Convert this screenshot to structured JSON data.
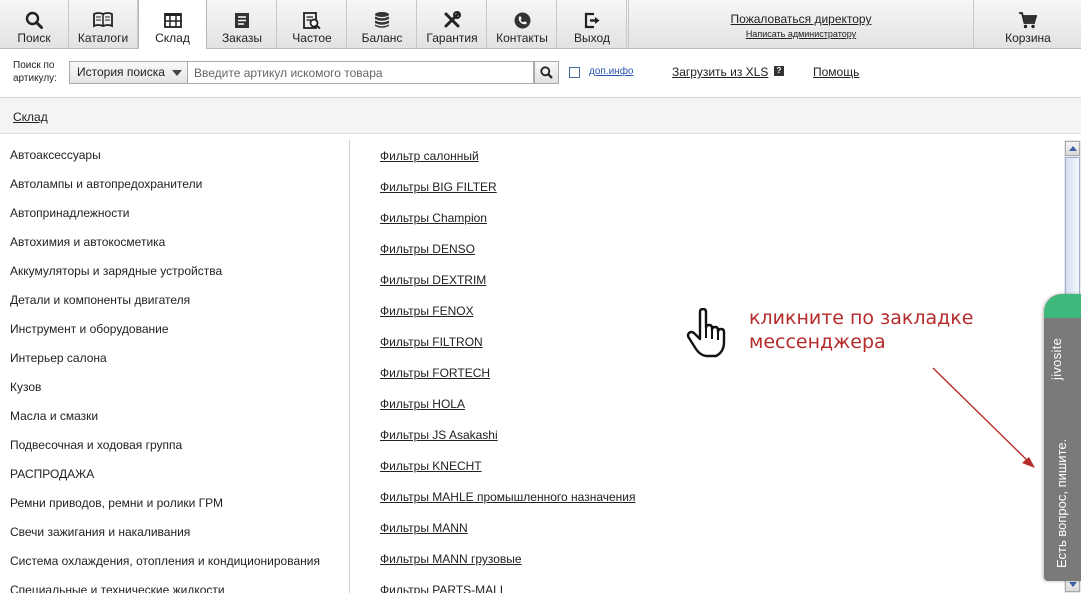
{
  "nav": {
    "items": [
      {
        "label": "Поиск",
        "icon": "search-icon"
      },
      {
        "label": "Каталоги",
        "icon": "book-icon"
      },
      {
        "label": "Склад",
        "icon": "warehouse-icon"
      },
      {
        "label": "Заказы",
        "icon": "orders-icon"
      },
      {
        "label": "Частое",
        "icon": "frequent-icon"
      },
      {
        "label": "Баланс",
        "icon": "coins-icon"
      },
      {
        "label": "Гарантия",
        "icon": "tools-icon"
      },
      {
        "label": "Контакты",
        "icon": "phone-icon"
      },
      {
        "label": "Выход",
        "icon": "exit-icon"
      }
    ],
    "active_index": 2,
    "director_link": "Пожаловаться директору",
    "admin_link": "Написать администратору",
    "cart_label": "Корзина"
  },
  "search": {
    "label_line1": "Поиск по",
    "label_line2": "артикулу:",
    "history_label": "История поиска",
    "placeholder": "Введите артикул искомого товара",
    "value": "",
    "dop_info_label": "доп.инфо",
    "dop_info_checked": false,
    "upload_xls_label": "Загрузить из XLS",
    "help_mark": "?",
    "help_label": "Помощь"
  },
  "breadcrumb": {
    "current": "Склад"
  },
  "categories": [
    "Автоаксессуары",
    "Автолампы и автопредохранители",
    "Автопринадлежности",
    "Автохимия и автокосметика",
    "Аккумуляторы и зарядные устройства",
    "Детали и компоненты двигателя",
    "Инструмент и оборудование",
    "Интерьер салона",
    "Кузов",
    "Масла и смазки",
    "Подвесочная и ходовая группа",
    "РАСПРОДАЖА",
    "Ремни приводов, ремни и ролики ГРМ",
    "Свечи зажигания и накаливания",
    "Система охлаждения, отопления и кондиционирования",
    "Специальные и технические жидкости"
  ],
  "items": [
    "Фильтр салонный",
    "Фильтры BIG FILTER",
    "Фильтры Champion",
    "Фильтры DENSO",
    "Фильтры DEXTRIM",
    "Фильтры FENOX",
    "Фильтры FILTRON",
    "Фильтры FORTECH",
    "Фильтры HOLA",
    "Фильтры JS Asakashi",
    "Фильтры KNECHT",
    "Фильтры MAHLE промышленного назначения",
    "Фильтры MANN",
    "Фильтры MANN грузовые",
    "Фильтры PARTS-MALL"
  ],
  "annotation": {
    "line1": "кликните по закладке",
    "line2": "мессенджера",
    "color": "#b52a2a"
  },
  "jivo": {
    "brand": "jivosite",
    "message": "Есть вопрос, пишите.",
    "accent": "#3fb87b"
  }
}
